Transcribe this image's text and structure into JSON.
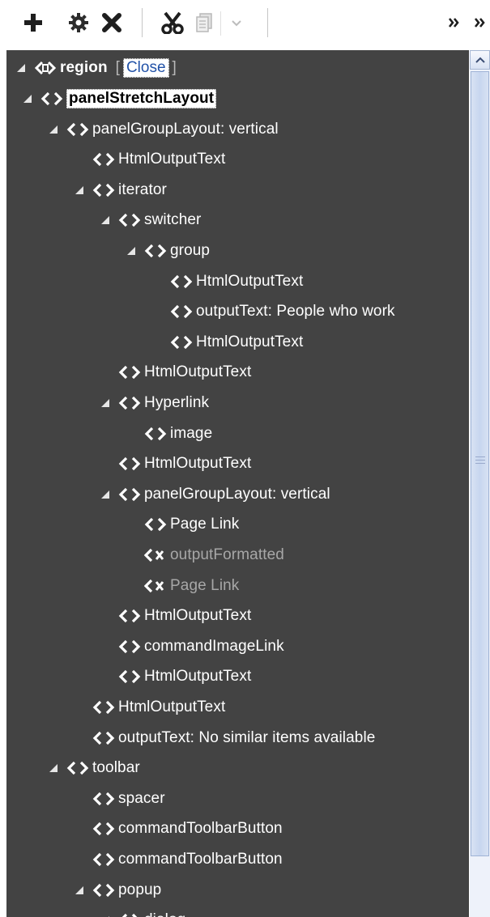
{
  "toolbar": {
    "buttons": [
      {
        "name": "add-button",
        "glyph": "add-icon",
        "enabled": true
      },
      {
        "name": "edit-properties-button",
        "glyph": "gear-icon",
        "enabled": true
      },
      {
        "name": "delete-button",
        "glyph": "close-icon",
        "enabled": true
      },
      {
        "name": "cut-button",
        "glyph": "scissors-icon",
        "enabled": true
      },
      {
        "name": "copy-button",
        "glyph": "copy-icon",
        "enabled": false
      },
      {
        "name": "copy-dropdown-button",
        "glyph": "chevron-down-icon",
        "enabled": false
      },
      {
        "name": "expand-right-button",
        "glyph": "double-chevron-right-icon",
        "enabled": true
      },
      {
        "name": "collapse-pane-button",
        "glyph": "double-chevron-right-icon",
        "enabled": true
      }
    ]
  },
  "tree": {
    "root": {
      "label": "region",
      "open_bracket": "[",
      "close_link": "Close",
      "close_bracket": "]"
    },
    "nodes": [
      {
        "label": "panelStretchLayout",
        "depth": 1,
        "expanded": true,
        "selected": true
      },
      {
        "label": "panelGroupLayout: vertical",
        "depth": 2,
        "expanded": true
      },
      {
        "label": "HtmlOutputText",
        "depth": 3
      },
      {
        "label": "iterator",
        "depth": 3,
        "expanded": true
      },
      {
        "label": "switcher",
        "depth": 4,
        "expanded": true
      },
      {
        "label": "group",
        "depth": 5,
        "expanded": true
      },
      {
        "label": "HtmlOutputText",
        "depth": 6
      },
      {
        "label": "outputText: People who work",
        "depth": 6
      },
      {
        "label": "HtmlOutputText",
        "depth": 6
      },
      {
        "label": "HtmlOutputText",
        "depth": 4
      },
      {
        "label": "Hyperlink",
        "depth": 4,
        "expanded": true
      },
      {
        "label": "image",
        "depth": 5
      },
      {
        "label": "HtmlOutputText",
        "depth": 4
      },
      {
        "label": "panelGroupLayout: vertical",
        "depth": 4,
        "expanded": true
      },
      {
        "label": "Page Link",
        "depth": 5
      },
      {
        "label": "outputFormatted",
        "depth": 5,
        "disabled": true
      },
      {
        "label": "Page Link",
        "depth": 5,
        "disabled": true
      },
      {
        "label": "HtmlOutputText",
        "depth": 4
      },
      {
        "label": "commandImageLink",
        "depth": 4
      },
      {
        "label": "HtmlOutputText",
        "depth": 4
      },
      {
        "label": "HtmlOutputText",
        "depth": 3
      },
      {
        "label": "outputText: No similar items available",
        "depth": 3
      },
      {
        "label": "toolbar",
        "depth": 2,
        "expanded": true
      },
      {
        "label": "spacer",
        "depth": 3
      },
      {
        "label": "commandToolbarButton",
        "depth": 3
      },
      {
        "label": "commandToolbarButton",
        "depth": 3
      },
      {
        "label": "popup",
        "depth": 3,
        "expanded": true
      },
      {
        "label": "dialog",
        "depth": 4,
        "expanded": true
      }
    ]
  },
  "scrollbar": {
    "position": "top"
  },
  "colors": {
    "tree_background": "#434343",
    "tree_text": "#ffffff",
    "disabled_text": "#a7a7a7",
    "link": "#2353a8"
  }
}
